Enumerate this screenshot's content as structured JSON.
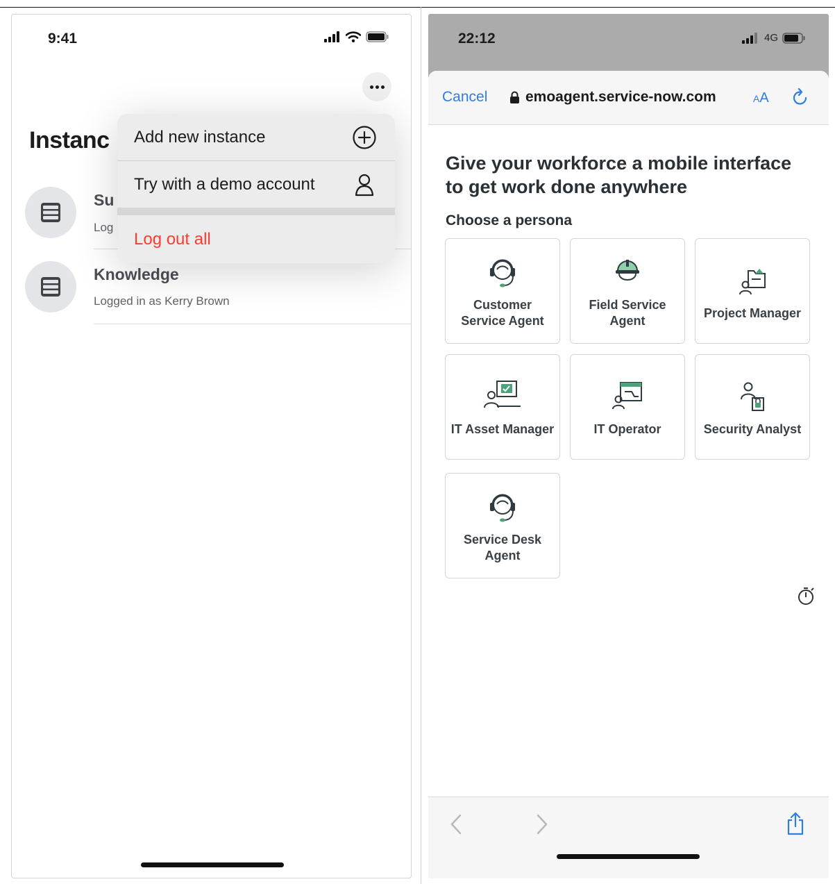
{
  "left_phone": {
    "status": {
      "time": "9:41"
    },
    "header": {
      "title": "Instanc",
      "more_icon": "ellipsis-icon"
    },
    "instances": [
      {
        "name": "Su",
        "subtitle": "Log",
        "icon": "server-icon"
      },
      {
        "name": "Knowledge",
        "subtitle": "Logged in as Kerry Brown",
        "icon": "server-icon"
      }
    ],
    "menu": {
      "items": [
        {
          "label": "Add new instance",
          "icon": "plus-circle-icon"
        },
        {
          "label": "Try with a demo account",
          "icon": "person-icon"
        }
      ],
      "logout_label": "Log out all",
      "logout_color": "#ff3b30"
    }
  },
  "right_phone": {
    "status": {
      "time": "22:12",
      "network": "4G"
    },
    "browser": {
      "cancel_label": "Cancel",
      "url": "emoagent.service-now.com",
      "text_size_label_small": "A",
      "text_size_label_large": "A",
      "accent_color": "#2f7de1"
    },
    "page": {
      "headline": "Give your workforce a mobile interface to get work done anywhere",
      "subheading": "Choose a persona",
      "personas": [
        {
          "label": "Customer Service Agent",
          "icon": "headset-agent-icon"
        },
        {
          "label": "Field Service Agent",
          "icon": "hard-hat-icon"
        },
        {
          "label": "Project Manager",
          "icon": "project-folder-icon"
        },
        {
          "label": "IT Asset Manager",
          "icon": "asset-screen-icon"
        },
        {
          "label": "IT Operator",
          "icon": "operator-console-icon"
        },
        {
          "label": "Security Analyst",
          "icon": "lock-person-icon"
        },
        {
          "label": "Service Desk Agent",
          "icon": "headset-agent-icon"
        }
      ]
    },
    "toolbar": {
      "icons": [
        "back-icon",
        "forward-icon",
        "share-icon"
      ]
    }
  }
}
